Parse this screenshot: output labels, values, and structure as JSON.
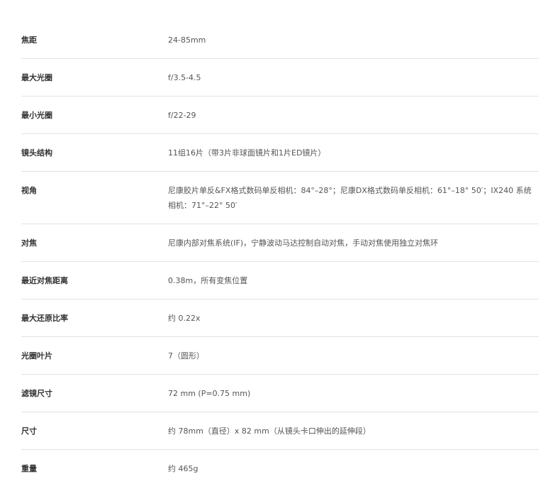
{
  "specs": [
    {
      "label": "焦距",
      "value": "24-85mm"
    },
    {
      "label": "最大光圈",
      "value": "f/3.5-4.5"
    },
    {
      "label": "最小光圈",
      "value": "f/22-29"
    },
    {
      "label": "镜头结构",
      "value": "11组16片（带3片非球面镜片和1片ED镜片）"
    },
    {
      "label": "视角",
      "value": "尼康胶片单反&FX格式数码单反相机：84°–28°；尼康DX格式数码单反相机：61°–18° 50′；IX240 系统相机：71°–22° 50′"
    },
    {
      "label": "对焦",
      "value": "尼康内部对焦系统(IF)，宁静波动马达控制自动对焦，手动对焦使用独立对焦环"
    },
    {
      "label": "最近对焦距离",
      "value": "0.38m，所有变焦位置"
    },
    {
      "label": "最大还原比率",
      "value": "约 0.22x"
    },
    {
      "label": "光圈叶片",
      "value": "7（圆形）"
    },
    {
      "label": "滤镜尺寸",
      "value": "72 mm (P=0.75 mm)"
    },
    {
      "label": "尺寸",
      "value": "约 78mm（直径）x 82 mm（从镜头卡口伸出的延伸段）"
    },
    {
      "label": "重量",
      "value": "约 465g"
    }
  ]
}
